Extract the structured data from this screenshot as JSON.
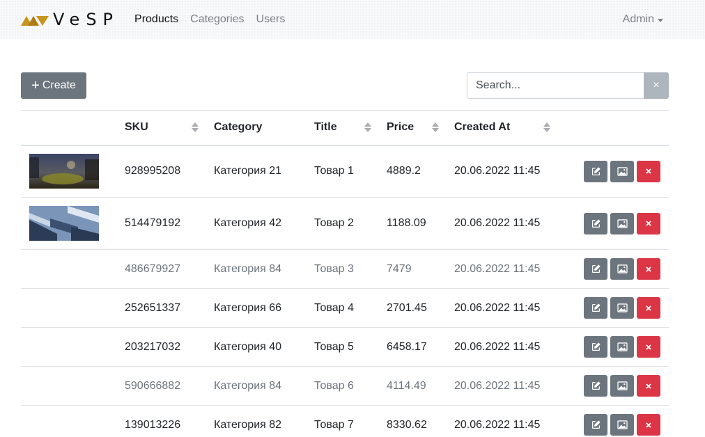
{
  "brand": {
    "name": "VeSP"
  },
  "nav": {
    "items": [
      {
        "label": "Products",
        "active": true
      },
      {
        "label": "Categories",
        "active": false
      },
      {
        "label": "Users",
        "active": false
      }
    ],
    "user_menu": "Admin"
  },
  "toolbar": {
    "create_label": "Create",
    "search_placeholder": "Search...",
    "clear_label": "×"
  },
  "table": {
    "columns": [
      "SKU",
      "Category",
      "Title",
      "Price",
      "Created At"
    ],
    "rows": [
      {
        "sku": "928995208",
        "category": "Категория 21",
        "title": "Товар 1",
        "price": "4889.2",
        "created": "20.06.2022 11:45",
        "image": "landscape",
        "muted": false
      },
      {
        "sku": "514479192",
        "category": "Категория 42",
        "title": "Товар 2",
        "price": "1188.09",
        "created": "20.06.2022 11:45",
        "image": "architecture",
        "muted": false
      },
      {
        "sku": "486679927",
        "category": "Категория 84",
        "title": "Товар 3",
        "price": "7479",
        "created": "20.06.2022 11:45",
        "image": "",
        "muted": true
      },
      {
        "sku": "252651337",
        "category": "Категория 66",
        "title": "Товар 4",
        "price": "2701.45",
        "created": "20.06.2022 11:45",
        "image": "",
        "muted": false
      },
      {
        "sku": "203217032",
        "category": "Категория 40",
        "title": "Товар 5",
        "price": "6458.17",
        "created": "20.06.2022 11:45",
        "image": "",
        "muted": false
      },
      {
        "sku": "590666882",
        "category": "Категория 84",
        "title": "Товар 6",
        "price": "4114.49",
        "created": "20.06.2022 11:45",
        "image": "",
        "muted": true
      },
      {
        "sku": "139013226",
        "category": "Категория 82",
        "title": "Товар 7",
        "price": "8330.62",
        "created": "20.06.2022 11:45",
        "image": "",
        "muted": false
      }
    ]
  },
  "icons": {
    "edit": "pencil-square-icon",
    "image": "image-icon",
    "delete": "x-icon",
    "plus": "plus-icon",
    "sort": "sort-icon"
  },
  "colors": {
    "secondary": "#6c757d",
    "danger": "#dc3545",
    "logo_gold": "#c8961e"
  }
}
